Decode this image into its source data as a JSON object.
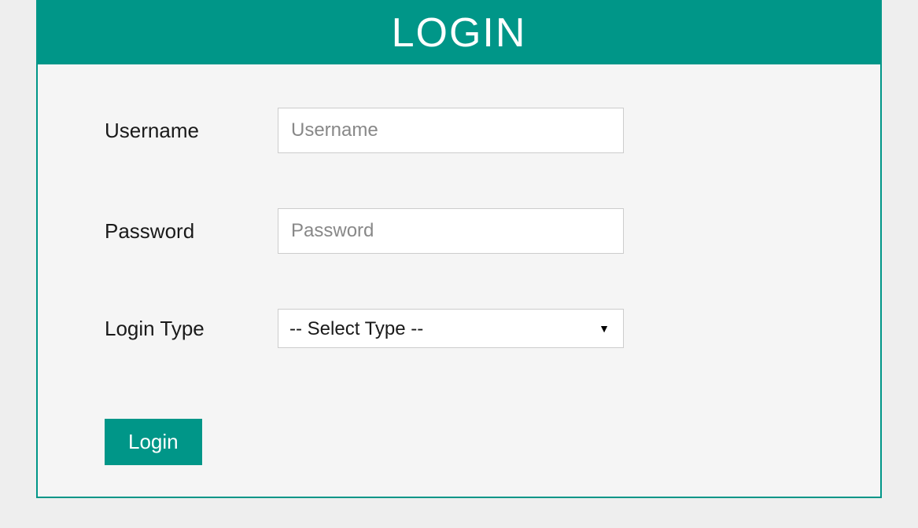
{
  "header": {
    "title": "LOGIN"
  },
  "form": {
    "username": {
      "label": "Username",
      "placeholder": "Username",
      "value": ""
    },
    "password": {
      "label": "Password",
      "placeholder": "Password",
      "value": ""
    },
    "login_type": {
      "label": "Login Type",
      "selected": "-- Select Type --"
    },
    "submit_label": "Login"
  },
  "colors": {
    "primary": "#009688",
    "background": "#eeeeee",
    "panel_bg": "#f5f5f5"
  }
}
